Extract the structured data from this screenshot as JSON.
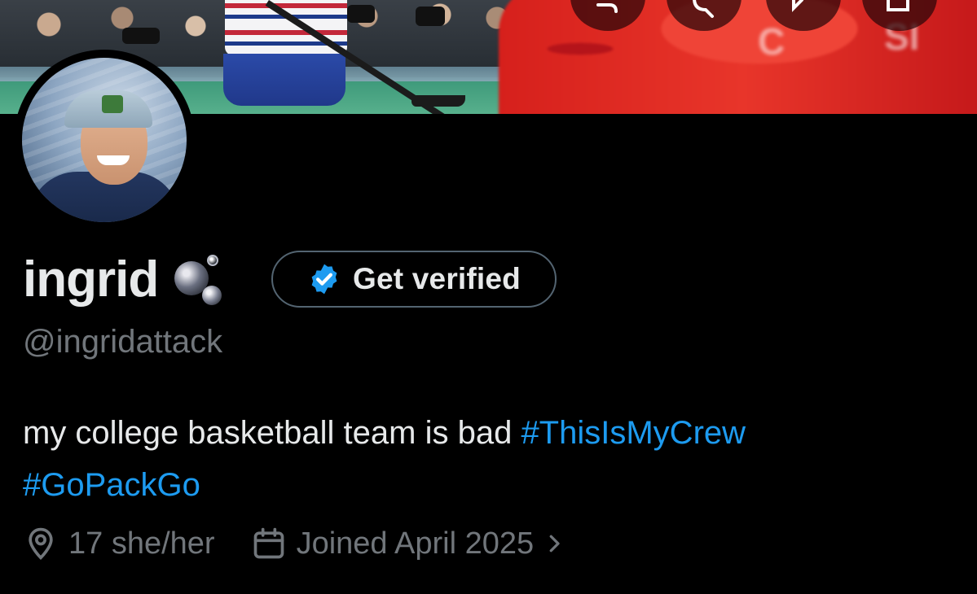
{
  "header": {
    "action_icons": [
      "repost-icon",
      "search-icon",
      "share-icon",
      "more-icon"
    ]
  },
  "profile": {
    "display_name": "ingrid",
    "name_emoji": "bubbles-emoji",
    "handle": "@ingridattack",
    "verify_button": {
      "label": "Get verified",
      "icon": "verified-badge-icon"
    },
    "bio": {
      "text": "my college basketball team is bad",
      "hashtags": [
        "#ThisIsMyCrew",
        "#GoPackGo"
      ]
    },
    "meta": {
      "location_icon": "location-pin-icon",
      "location": "17 she/her",
      "joined_icon": "calendar-icon",
      "joined": "Joined April 2025",
      "joined_chevron": "chevron-right-icon"
    }
  },
  "colors": {
    "background": "#000000",
    "text_primary": "#e7e9ea",
    "text_secondary": "#71767b",
    "link": "#1d9bf0",
    "border": "#536471",
    "verified_badge": "#1d9bf0"
  }
}
